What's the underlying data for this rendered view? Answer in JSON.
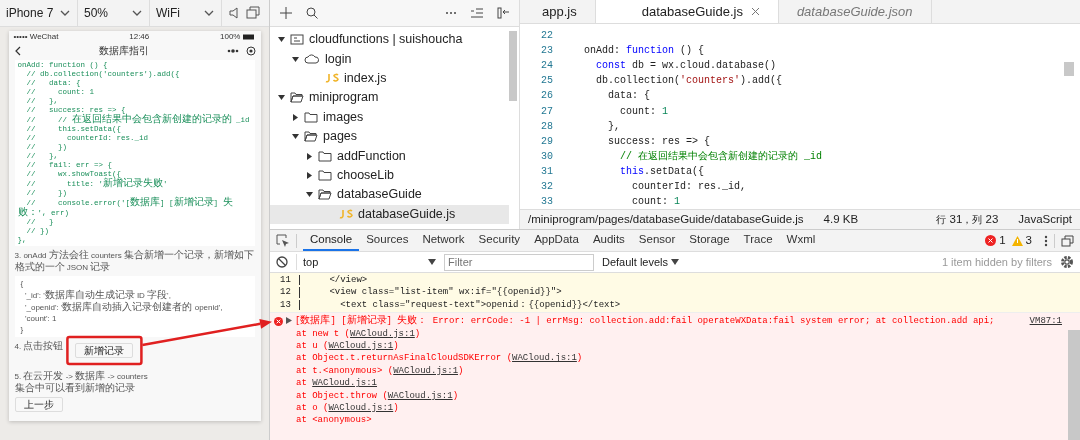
{
  "simulator": {
    "device": "iPhone 7",
    "zoom": "50%",
    "network": "WiFi",
    "phone": {
      "carrier": "••••• WeChat",
      "time": "12:46",
      "battery": "100%",
      "title": "数据库指引",
      "code_lines": [
        "onAdd: function () {",
        "  // db.collection('counters').add({",
        "  //   data: {",
        "  //     count: 1",
        "  //   },",
        "  //   success: res => {",
        "  //     // 在返回结果中会包含新创建的记录的 _id",
        "  //     this.setData({",
        "  //       counterId: res._id",
        "  //     })",
        "  //   },",
        "  //   fail: err => {",
        "  //     wx.showToast({",
        "  //       title: '新增记录失败'",
        "  //     })",
        "  //     console.error('[数据库] [新增记录] 失败：', err)",
        "  //   }",
        "  // })",
        "},"
      ],
      "step_3": "3. onAdd 方法会往 counters 集合新增一个记录，新增如下格式的一个 JSON 记录",
      "json_lines": [
        "{",
        "  '_id': '数据库自动生成记录 ID 字段',",
        "  '_openid': '数据库自动插入记录创建者的 openid',",
        "  'count': 1",
        "}"
      ],
      "step_4": "4. 点击按钮",
      "add_button": "新增记录",
      "step_5": "5. 在云开发 -> 数据库 -> counters 集合中可以看到新增的记录",
      "prev_button": "上一步"
    }
  },
  "file_tree": [
    {
      "label": "cloudfunctions | suishoucha",
      "kind": "cloud-root",
      "expanded": true,
      "selected": false,
      "children": [
        {
          "label": "login",
          "kind": "cloud-function",
          "expanded": true,
          "selected": false,
          "children": [
            {
              "label": "index.js",
              "kind": "js",
              "selected": false
            }
          ]
        }
      ]
    },
    {
      "label": "miniprogram",
      "kind": "folder",
      "expanded": true,
      "selected": false,
      "children": [
        {
          "label": "images",
          "kind": "folder",
          "expanded": false,
          "selected": false
        },
        {
          "label": "pages",
          "kind": "folder",
          "expanded": true,
          "selected": false,
          "children": [
            {
              "label": "addFunction",
              "kind": "folder",
              "expanded": false,
              "selected": false
            },
            {
              "label": "chooseLib",
              "kind": "folder",
              "expanded": false,
              "selected": false
            },
            {
              "label": "databaseGuide",
              "kind": "folder",
              "expanded": true,
              "selected": false,
              "children": [
                {
                  "label": "databaseGuide.js",
                  "kind": "js",
                  "selected": true
                }
              ]
            }
          ]
        }
      ]
    }
  ],
  "editor": {
    "tabs": [
      {
        "label": "app.js",
        "selected": false,
        "preview": false,
        "closable": false
      },
      {
        "label": "databaseGuide.js",
        "selected": true,
        "preview": false,
        "closable": true
      },
      {
        "label": "databaseGuide.json",
        "selected": false,
        "preview": true,
        "closable": false
      }
    ],
    "lines": [
      {
        "number": "22"
      },
      {
        "number": "23",
        "tokens": [
          {
            "text": "onAdd: ",
            "kind": "plain"
          },
          {
            "text": "function",
            "kind": "keyword"
          },
          {
            "text": " () {",
            "kind": "plain"
          }
        ]
      },
      {
        "number": "24",
        "tokens": [
          {
            "text": "  const",
            "kind": "keyword"
          },
          {
            "text": " db = wx.cloud.database()",
            "kind": "plain"
          }
        ]
      },
      {
        "number": "25",
        "tokens": [
          {
            "text": "  db.collection(",
            "kind": "plain"
          },
          {
            "text": "'counters'",
            "kind": "string"
          },
          {
            "text": ").add({",
            "kind": "plain"
          }
        ]
      },
      {
        "number": "26",
        "tokens": [
          {
            "text": "    data: {",
            "kind": "plain"
          }
        ]
      },
      {
        "number": "27",
        "tokens": [
          {
            "text": "      count: ",
            "kind": "plain"
          },
          {
            "text": "1",
            "kind": "number"
          }
        ]
      },
      {
        "number": "28",
        "tokens": [
          {
            "text": "    },",
            "kind": "plain"
          }
        ]
      },
      {
        "number": "29",
        "tokens": [
          {
            "text": "    success: res => {",
            "kind": "plain"
          }
        ]
      },
      {
        "number": "30",
        "tokens": [
          {
            "text": "      // 在返回结果中会包含新创建的记录的 _id",
            "kind": "comment"
          }
        ]
      },
      {
        "number": "31",
        "tokens": [
          {
            "text": "      this",
            "kind": "keyword"
          },
          {
            "text": ".setData({",
            "kind": "plain"
          }
        ]
      },
      {
        "number": "32",
        "tokens": [
          {
            "text": "        counterId: res._id,",
            "kind": "plain"
          }
        ]
      },
      {
        "number": "33",
        "tokens": [
          {
            "text": "        count: ",
            "kind": "plain"
          },
          {
            "text": "1",
            "kind": "number"
          }
        ]
      }
    ],
    "status_bar": {
      "path": "/miniprogram/pages/databaseGuide/databaseGuide.js",
      "size": "4.9 KB",
      "position": "行 31，列 23",
      "language": "JavaScript"
    }
  },
  "devtools": {
    "tabs": [
      {
        "label": "Console",
        "selected": true
      },
      {
        "label": "Sources",
        "selected": false
      },
      {
        "label": "Network",
        "selected": false
      },
      {
        "label": "Security",
        "selected": false
      },
      {
        "label": "AppData",
        "selected": false
      },
      {
        "label": "Audits",
        "selected": false
      },
      {
        "label": "Sensor",
        "selected": false
      },
      {
        "label": "Storage",
        "selected": false
      },
      {
        "label": "Trace",
        "selected": false
      },
      {
        "label": "Wxml",
        "selected": false
      }
    ],
    "error_count": "1",
    "warning_count": "3",
    "filter_bar": {
      "context": "top",
      "placeholder": "Filter",
      "levels": "Default levels",
      "hidden_note": "1 item hidden by filters"
    },
    "source_lines": [
      {
        "number": "11",
        "code": "    </view>"
      },
      {
        "number": "12",
        "code": "    <view class=\"list-item\" wx:if=\"{{openid}}\">"
      },
      {
        "number": "13",
        "code": "      <text class=\"request-text\">openid：{{openid}}</text>"
      }
    ],
    "error": {
      "message": "[数据库] [新增记录] 失败：  Error: errCode: -1  | errMsg: collection.add:fail operateWXData:fail system error; at collection.add api;",
      "source": "VM87:1",
      "stack": [
        {
          "before": "at new t (",
          "link": "WACloud.js:1",
          "after": ")"
        },
        {
          "before": "at u (",
          "link": "WACloud.js:1",
          "after": ")"
        },
        {
          "before": "at Object.t.returnAsFinalCloudSDKError (",
          "link": "WACloud.js:1",
          "after": ")"
        },
        {
          "before": "at t.<anonymous> (",
          "link": "WACloud.js:1",
          "after": ")"
        },
        {
          "before": "at ",
          "link": "WACloud.js:1"
        },
        {
          "before": "at Object.throw (",
          "link": "WACloud.js:1",
          "after": ")"
        },
        {
          "before": "at o (",
          "link": "WACloud.js:1",
          "after": ")"
        },
        {
          "before": "at <anonymous>"
        }
      ]
    }
  }
}
